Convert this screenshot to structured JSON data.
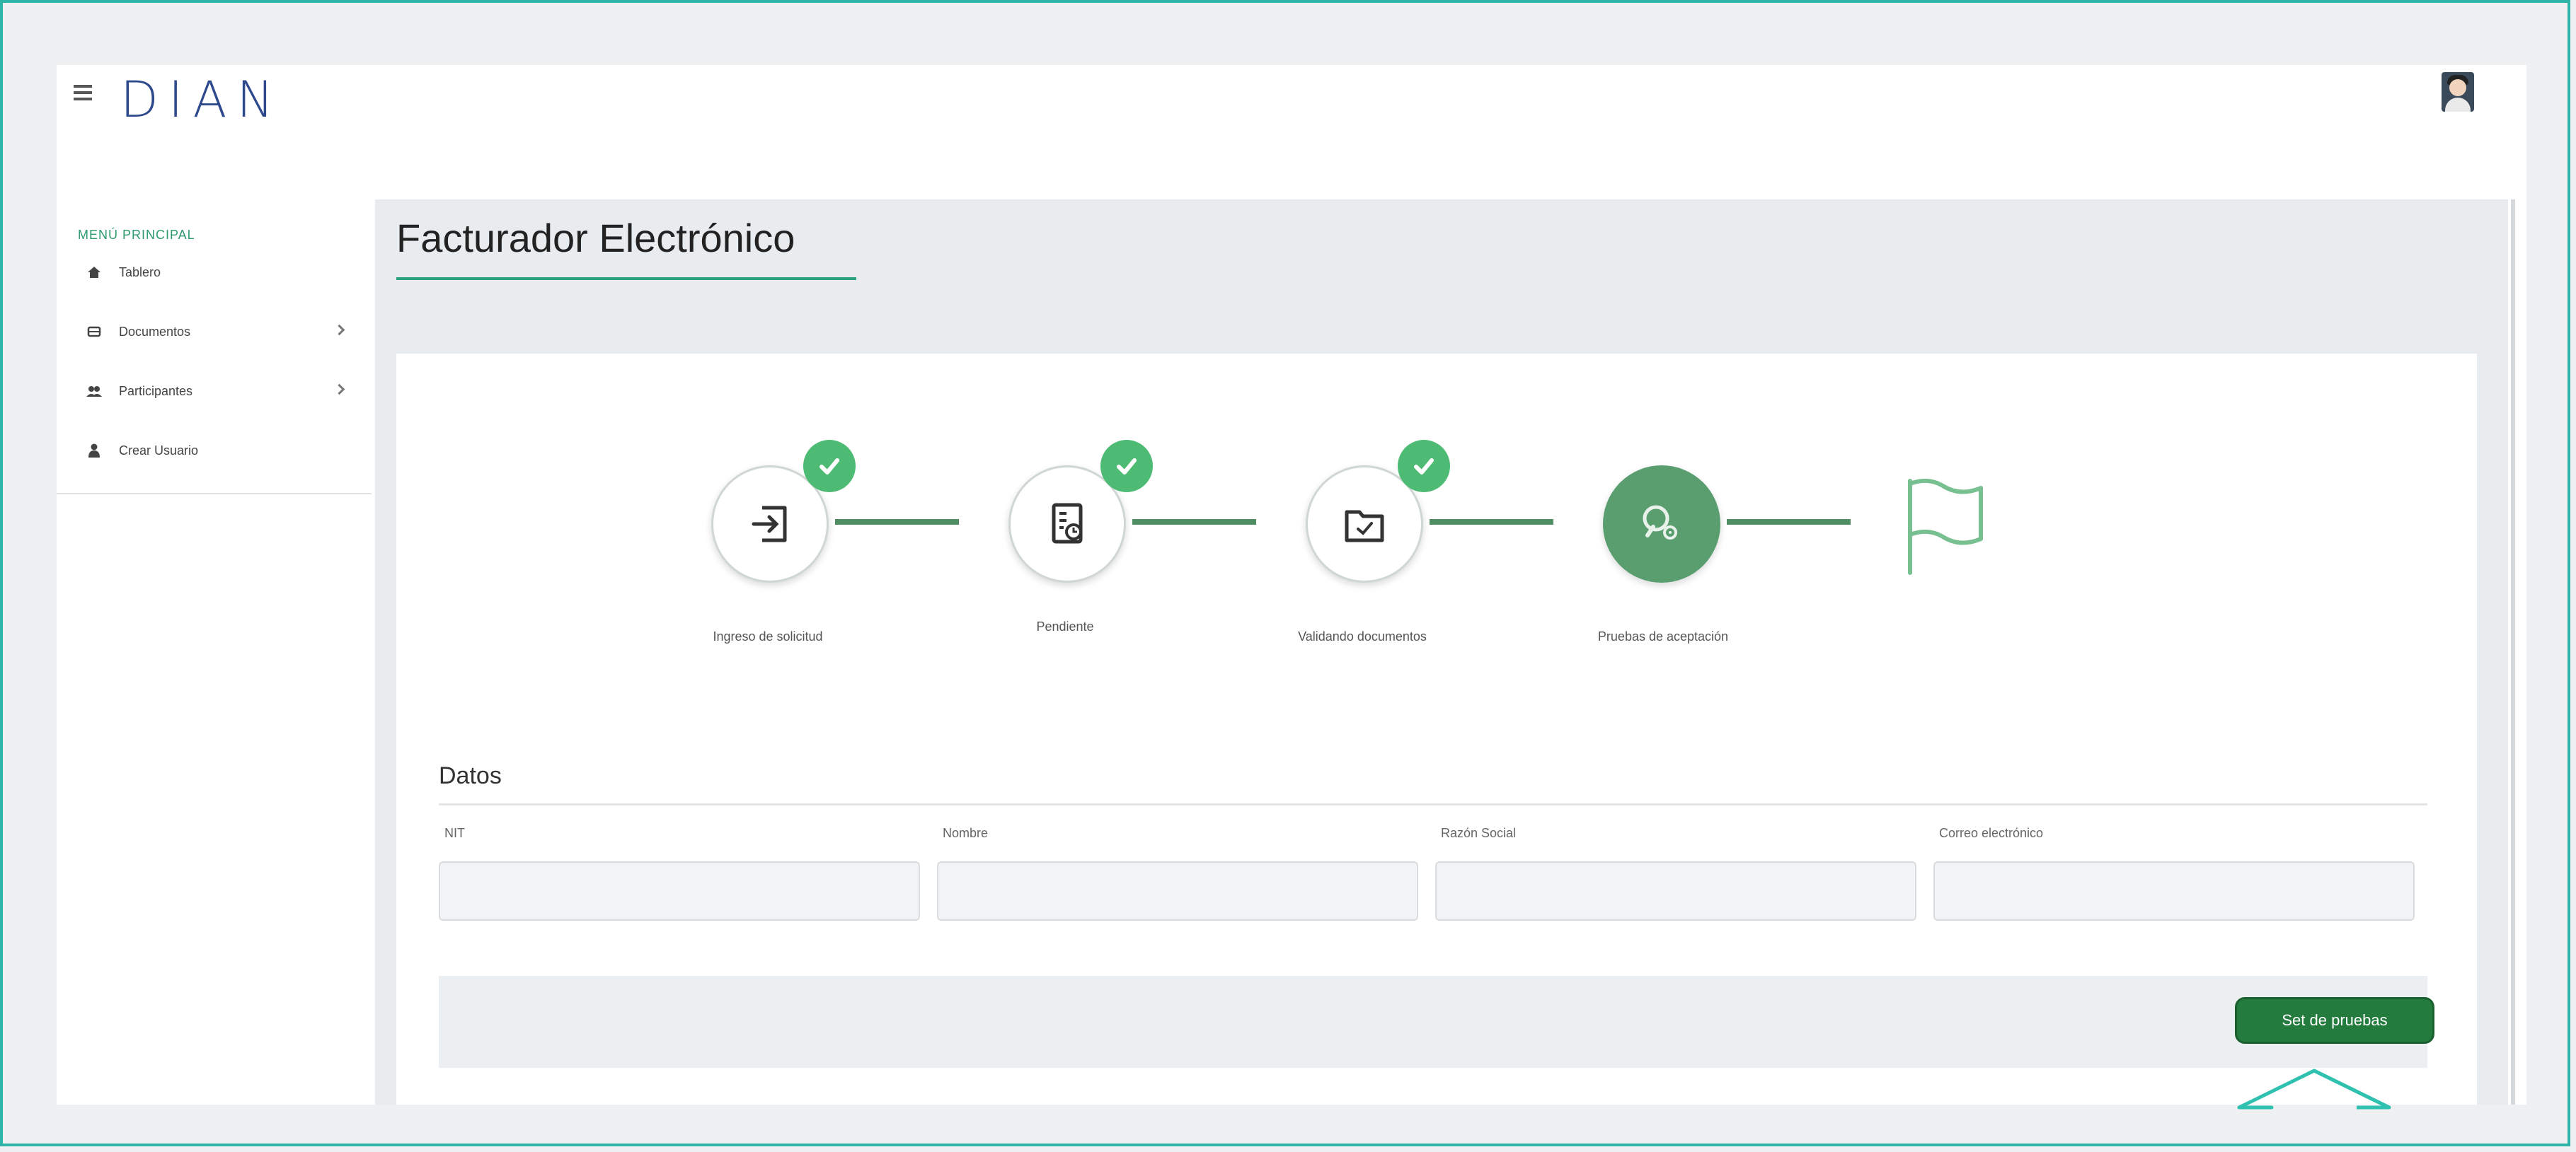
{
  "header": {
    "logo_text": "DIAN"
  },
  "sidebar": {
    "title": "MENÚ PRINCIPAL",
    "items": [
      {
        "label": "Tablero",
        "icon": "home-icon"
      },
      {
        "label": "Documentos",
        "icon": "document-icon",
        "expandable": true
      },
      {
        "label": "Participantes",
        "icon": "users-icon",
        "expandable": true
      },
      {
        "label": "Crear Usuario",
        "icon": "user-add-icon"
      }
    ]
  },
  "main": {
    "title": "Facturador Electrónico",
    "steps": [
      {
        "label": "Ingreso de solicitud",
        "completed": true
      },
      {
        "label": "Pendiente",
        "completed": true
      },
      {
        "label": "Validando documentos",
        "completed": true
      },
      {
        "label": "Pruebas de aceptación",
        "completed": false,
        "active": true
      },
      {
        "label": "",
        "completed": false
      }
    ],
    "datos": {
      "title": "Datos",
      "fields": [
        {
          "label": "NIT",
          "value": ""
        },
        {
          "label": "Nombre",
          "value": ""
        },
        {
          "label": "Razón Social",
          "value": ""
        },
        {
          "label": "Correo electrónico",
          "value": ""
        }
      ]
    },
    "action_button": "Set de pruebas"
  },
  "colors": {
    "accent": "#2fa27d",
    "button": "#237b3e",
    "check": "#4dbb73",
    "frame": "#2fb4a8"
  }
}
